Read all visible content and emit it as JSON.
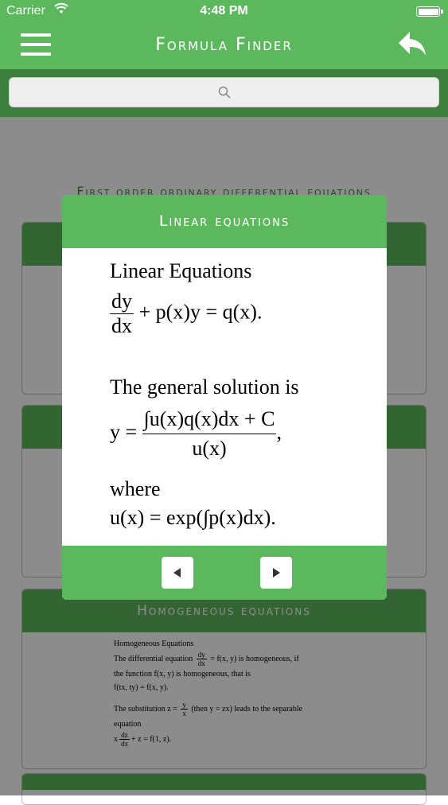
{
  "status_bar": {
    "carrier": "Carrier",
    "time": "4:48 PM"
  },
  "nav": {
    "title": "Formula Finder"
  },
  "icons": {
    "menu": "hamburger-menu-icon",
    "back": "reply-back-icon",
    "search": "magnifier-icon",
    "prev": "triangle-left-icon",
    "next": "triangle-right-icon",
    "wifi": "wifi-icon",
    "battery": "battery-icon"
  },
  "colors": {
    "green": "#5cb85c",
    "dark_green": "#3d7f3d",
    "section_title": "#3d8a3d"
  },
  "section": {
    "title": "First order ordinary differential equations"
  },
  "cards": [
    {
      "title": ""
    },
    {
      "title": ""
    },
    {
      "title": "Homogeneous equations",
      "lines": [
        "Homogeneous Equations",
        "The differential equation",
        "= f(x, y)  is homogeneous, if",
        "the function f(x, y) is homogeneous, that is",
        "f(tx, ty) = f(x, y).",
        "The substitution z =",
        "(then y = zx) leads to the separable",
        "equation",
        "+ z = f(1, z)."
      ]
    }
  ],
  "modal": {
    "title": "Linear equations",
    "heading": "Linear Equations",
    "eq1_num": "dy",
    "eq1_den": "dx",
    "eq1_rest": "+ p(x)y = q(x).",
    "general": "The general solution is",
    "eq2_lhs": "y =",
    "eq2_num": "∫u(x)q(x)dx + C",
    "eq2_den": "u(x)",
    "eq2_tail": ",",
    "where": "where",
    "eq3": "u(x) = exp(∫p(x)dx)."
  }
}
